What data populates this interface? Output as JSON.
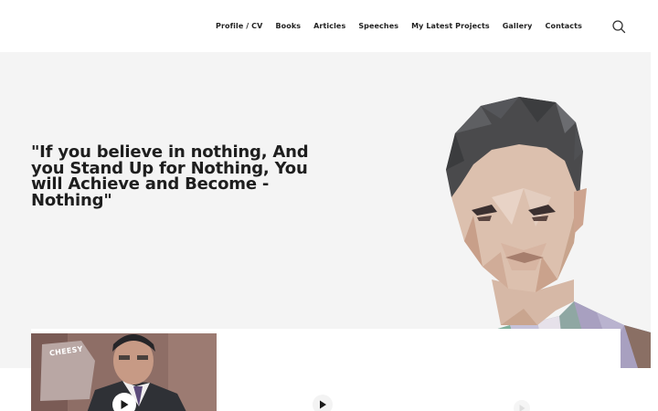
{
  "nav": {
    "items": [
      {
        "label": "Profile / CV"
      },
      {
        "label": "Books"
      },
      {
        "label": "Articles"
      },
      {
        "label": "Speeches"
      },
      {
        "label": "My Latest Projects"
      },
      {
        "label": "Gallery"
      },
      {
        "label": "Contacts"
      }
    ],
    "search_icon": "search-icon"
  },
  "hero": {
    "quote": "\"If you believe in nothing, And you Stand Up for Nothing, You will Achieve and Become - Nothing\"",
    "portrait": "low-poly-portrait"
  },
  "videos": [
    {
      "thumbnail_text": "CHEESY",
      "icon": "play-icon"
    },
    {
      "icon": "play-icon"
    },
    {
      "icon": "play-icon"
    }
  ],
  "colors": {
    "hero_bg": "#f4f4f4",
    "text": "#1e1e1e"
  }
}
